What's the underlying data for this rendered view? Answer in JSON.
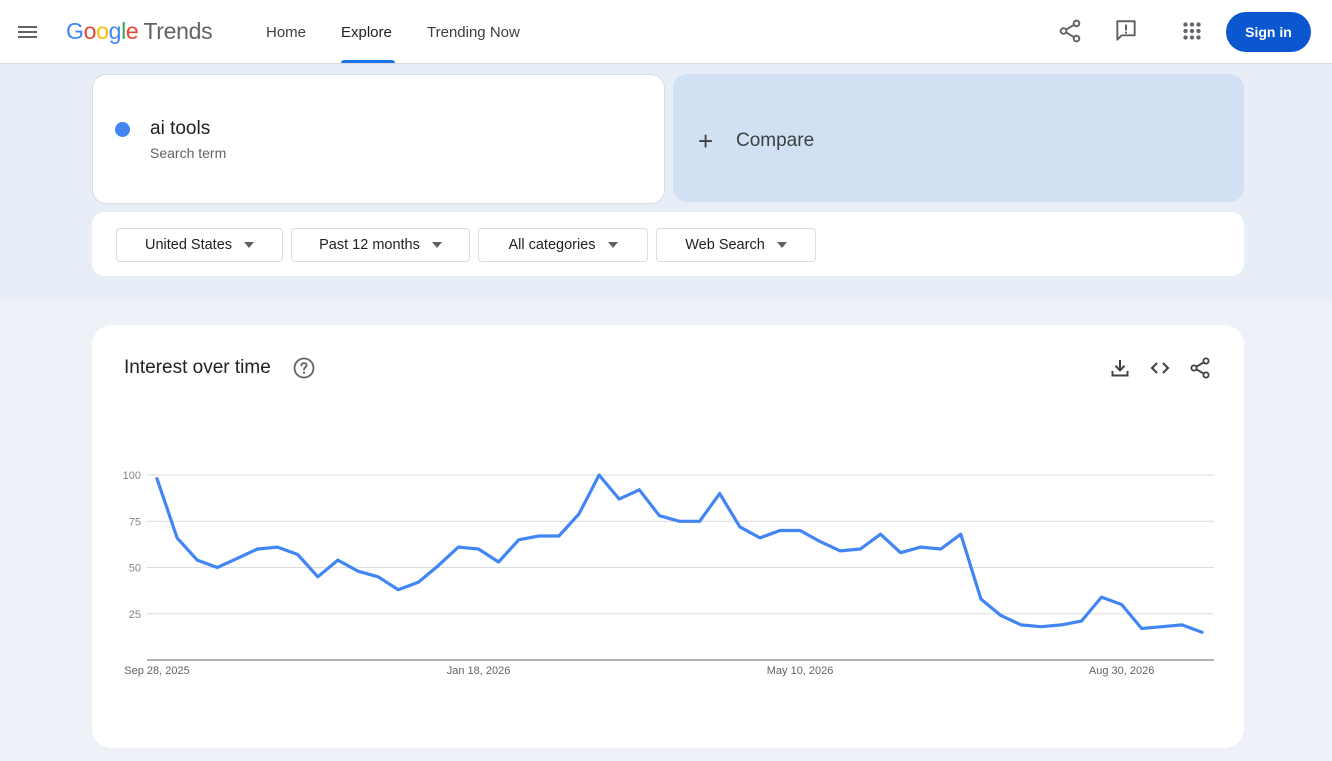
{
  "header": {
    "logo_letters": [
      "G",
      "o",
      "o",
      "g",
      "l",
      "e"
    ],
    "logo_product": "Trends",
    "nav": [
      "Home",
      "Explore",
      "Trending Now"
    ],
    "sign_in": "Sign in",
    "icons": [
      "menu-icon",
      "share-icon",
      "feedback-icon",
      "apps-icon"
    ]
  },
  "search": {
    "term": "ai tools",
    "term_sublabel": "Search term",
    "term_color": "#4285f4",
    "compare_label": "Compare"
  },
  "filters": {
    "region": "United States",
    "time": "Past 12 months",
    "category": "All categories",
    "property": "Web Search"
  },
  "chart_card": {
    "title": "Interest over time",
    "icons": [
      "help-icon",
      "download-icon",
      "embed-icon",
      "share-icon"
    ]
  },
  "chart_data": {
    "type": "line",
    "title": "Interest over time",
    "ylim": [
      0,
      100
    ],
    "yticks": [
      25,
      50,
      75,
      100
    ],
    "x_tick_labels": [
      "Sep 28, 2025",
      "Jan 18, 2026",
      "May 10, 2026",
      "Aug 30, 2026"
    ],
    "x_tick_indices": [
      0,
      16,
      32,
      48
    ],
    "grid": true,
    "series": [
      {
        "name": "ai tools",
        "color": "#4285f4",
        "values": [
          98,
          66,
          54,
          50,
          55,
          60,
          61,
          57,
          45,
          54,
          48,
          45,
          38,
          42,
          51,
          61,
          60,
          53,
          65,
          67,
          67,
          79,
          100,
          87,
          92,
          78,
          75,
          75,
          90,
          72,
          66,
          70,
          70,
          64,
          59,
          60,
          68,
          58,
          61,
          60,
          68,
          33,
          24,
          19,
          18,
          19,
          21,
          34,
          30,
          17,
          18,
          19,
          15
        ]
      }
    ]
  }
}
